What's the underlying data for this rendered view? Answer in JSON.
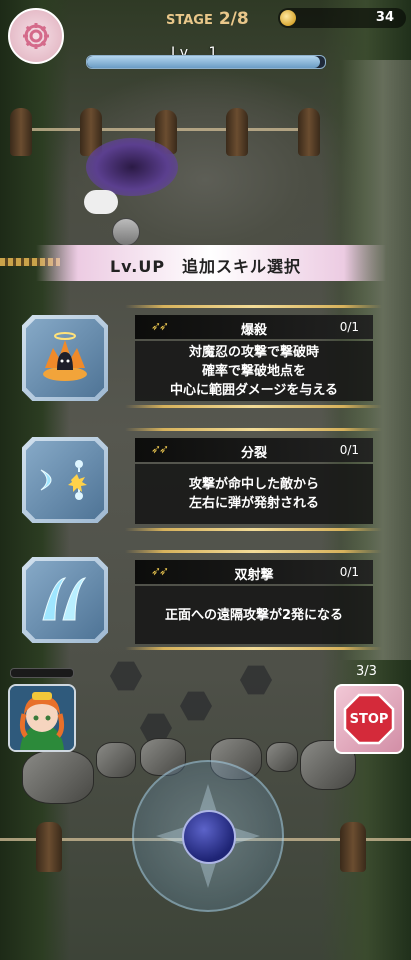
{
  "hud": {
    "stage_label": "STAGE",
    "stage_value": "2/8",
    "coins": "34",
    "level_label": "Lv.　1",
    "xp_progress": 0.98,
    "settings_icon": "gear-icon"
  },
  "levelup": {
    "title": "Lv.UP　追加スキル選択",
    "skills": [
      {
        "name": "爆殺",
        "count": "0/1",
        "desc": [
          "対魔忍の攻撃で撃破時",
          "確率で撃破地点を",
          "中心に範囲ダメージを与える"
        ],
        "icon": "explosion-icon"
      },
      {
        "name": "分裂",
        "count": "0/1",
        "desc": [
          "攻撃が命中した敵から",
          "左右に弾が発射される"
        ],
        "icon": "split-shot-icon"
      },
      {
        "name": "双射撃",
        "count": "0/1",
        "desc": [
          "正面への遠隔攻撃が2発になる"
        ],
        "icon": "double-shot-icon"
      }
    ]
  },
  "controls": {
    "character_gauge": 0.0,
    "stop_count": "3/3",
    "stop_label": "STOP"
  },
  "colors": {
    "accent_gold": "#d7b25c",
    "stage_text": "#e9c78a",
    "xp_fill": "#8fb8dc"
  }
}
